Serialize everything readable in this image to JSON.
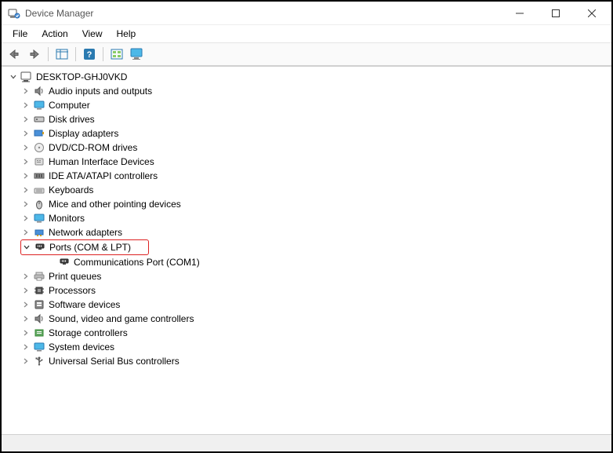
{
  "window": {
    "title": "Device Manager"
  },
  "menu": {
    "file": "File",
    "action": "Action",
    "view": "View",
    "help": "Help"
  },
  "tree": {
    "root": "DESKTOP-GHJ0VKD",
    "audio": "Audio inputs and outputs",
    "computer": "Computer",
    "disk": "Disk drives",
    "display": "Display adapters",
    "dvd": "DVD/CD-ROM drives",
    "hid": "Human Interface Devices",
    "ide": "IDE ATA/ATAPI controllers",
    "keyboards": "Keyboards",
    "mice": "Mice and other pointing devices",
    "monitors": "Monitors",
    "network": "Network adapters",
    "ports": "Ports (COM & LPT)",
    "ports_child_com1": "Communications Port (COM1)",
    "printqueues": "Print queues",
    "processors": "Processors",
    "softwaredev": "Software devices",
    "sound": "Sound, video and game controllers",
    "storage": "Storage controllers",
    "sysdev": "System devices",
    "usb": "Universal Serial Bus controllers"
  }
}
